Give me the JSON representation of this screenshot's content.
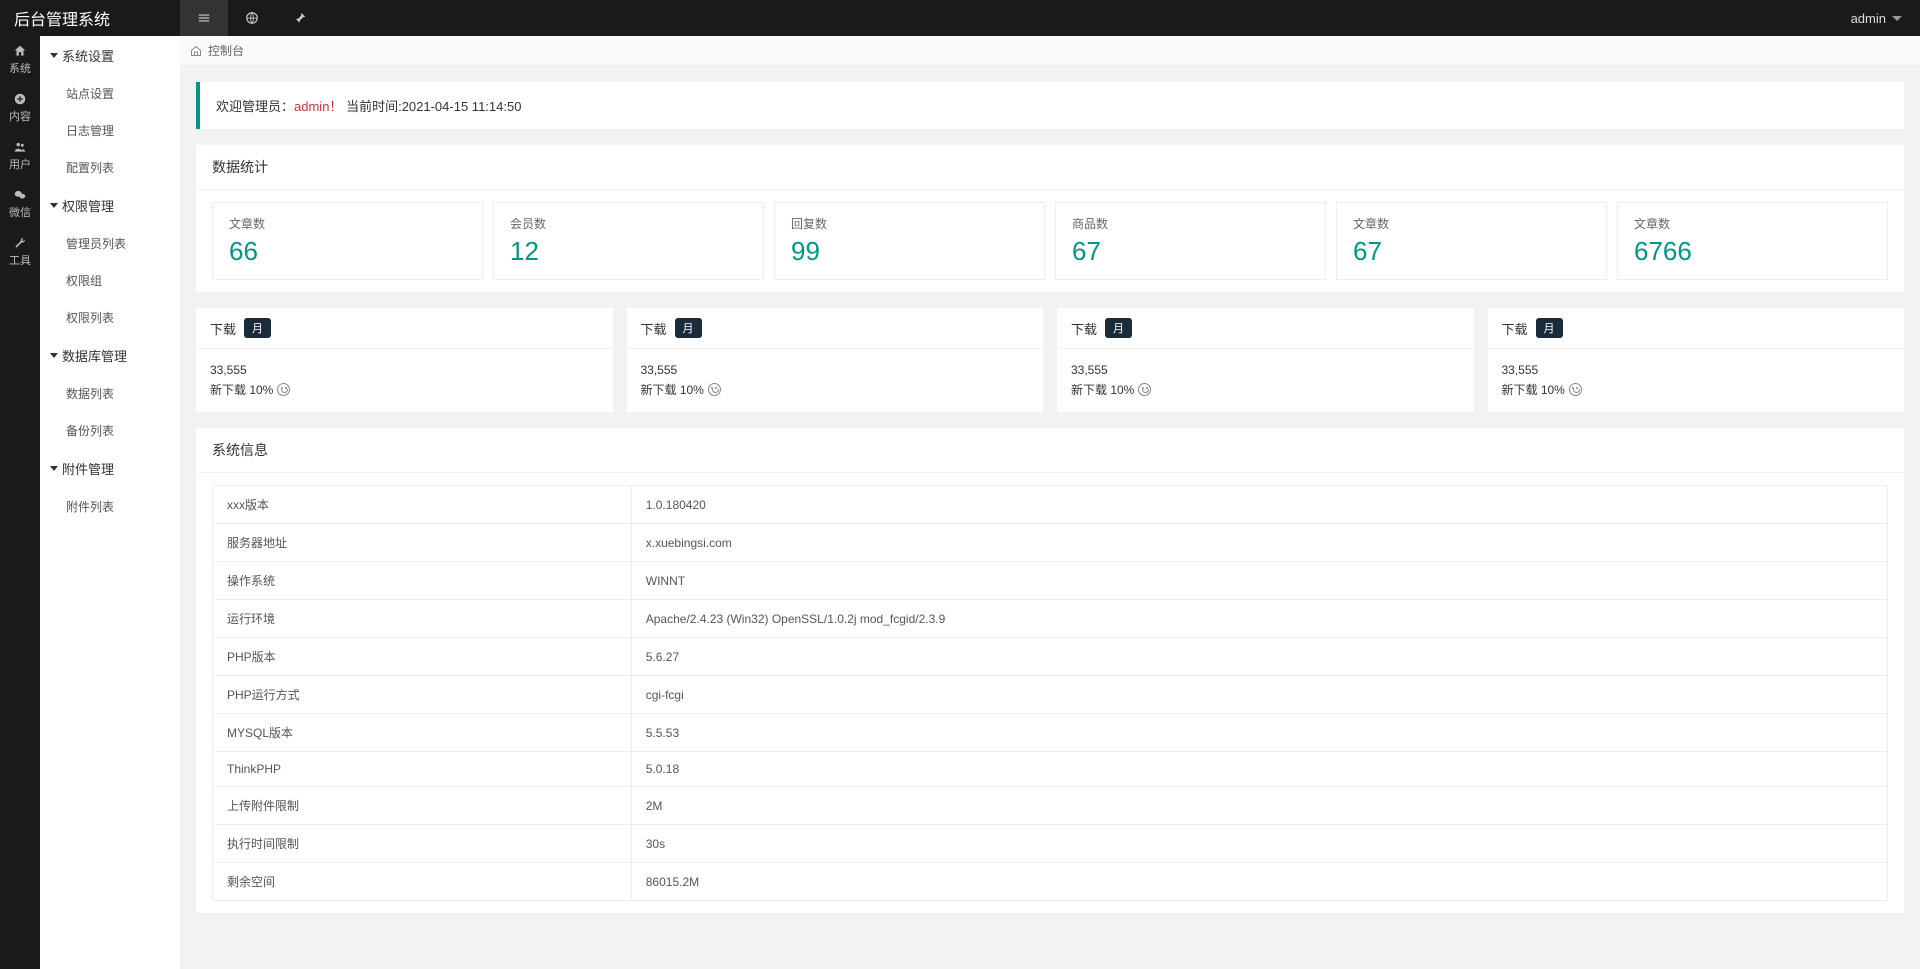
{
  "header": {
    "title": "后台管理系统",
    "user": "admin"
  },
  "icon_sidebar": [
    {
      "name": "system",
      "label": "系统"
    },
    {
      "name": "content",
      "label": "内容"
    },
    {
      "name": "users",
      "label": "用户"
    },
    {
      "name": "wechat",
      "label": "微信"
    },
    {
      "name": "tools",
      "label": "工具"
    }
  ],
  "text_sidebar": [
    {
      "title": "系统设置",
      "items": [
        "站点设置",
        "日志管理",
        "配置列表"
      ]
    },
    {
      "title": "权限管理",
      "items": [
        "管理员列表",
        "权限组",
        "权限列表"
      ]
    },
    {
      "title": "数据库管理",
      "items": [
        "数据列表",
        "备份列表"
      ]
    },
    {
      "title": "附件管理",
      "items": [
        "附件列表"
      ]
    }
  ],
  "breadcrumb": "控制台",
  "welcome": {
    "prefix": "欢迎管理员：",
    "user": "admin！",
    "time_label": "当前时间:",
    "time_value": "2021-04-15 11:14:50"
  },
  "stats": {
    "title": "数据统计",
    "cards": [
      {
        "label": "文章数",
        "value": "66"
      },
      {
        "label": "会员数",
        "value": "12"
      },
      {
        "label": "回复数",
        "value": "99"
      },
      {
        "label": "商品数",
        "value": "67"
      },
      {
        "label": "文章数",
        "value": "67"
      },
      {
        "label": "文章数",
        "value": "6766"
      }
    ]
  },
  "downloads": [
    {
      "title": "下载",
      "badge": "月",
      "count": "33,555",
      "sub": "新下载 10%"
    },
    {
      "title": "下载",
      "badge": "月",
      "count": "33,555",
      "sub": "新下载 10%"
    },
    {
      "title": "下载",
      "badge": "月",
      "count": "33,555",
      "sub": "新下载 10%"
    },
    {
      "title": "下载",
      "badge": "月",
      "count": "33,555",
      "sub": "新下载 10%"
    }
  ],
  "sysinfo": {
    "title": "系统信息",
    "rows": [
      {
        "k": "xxx版本",
        "v": "1.0.180420"
      },
      {
        "k": "服务器地址",
        "v": "x.xuebingsi.com"
      },
      {
        "k": "操作系统",
        "v": "WINNT"
      },
      {
        "k": "运行环境",
        "v": "Apache/2.4.23 (Win32) OpenSSL/1.0.2j mod_fcgid/2.3.9"
      },
      {
        "k": "PHP版本",
        "v": "5.6.27"
      },
      {
        "k": "PHP运行方式",
        "v": "cgi-fcgi"
      },
      {
        "k": "MYSQL版本",
        "v": "5.5.53"
      },
      {
        "k": "ThinkPHP",
        "v": "5.0.18"
      },
      {
        "k": "上传附件限制",
        "v": "2M"
      },
      {
        "k": "执行时间限制",
        "v": "30s"
      },
      {
        "k": "剩余空间",
        "v": "86015.2M"
      }
    ]
  }
}
